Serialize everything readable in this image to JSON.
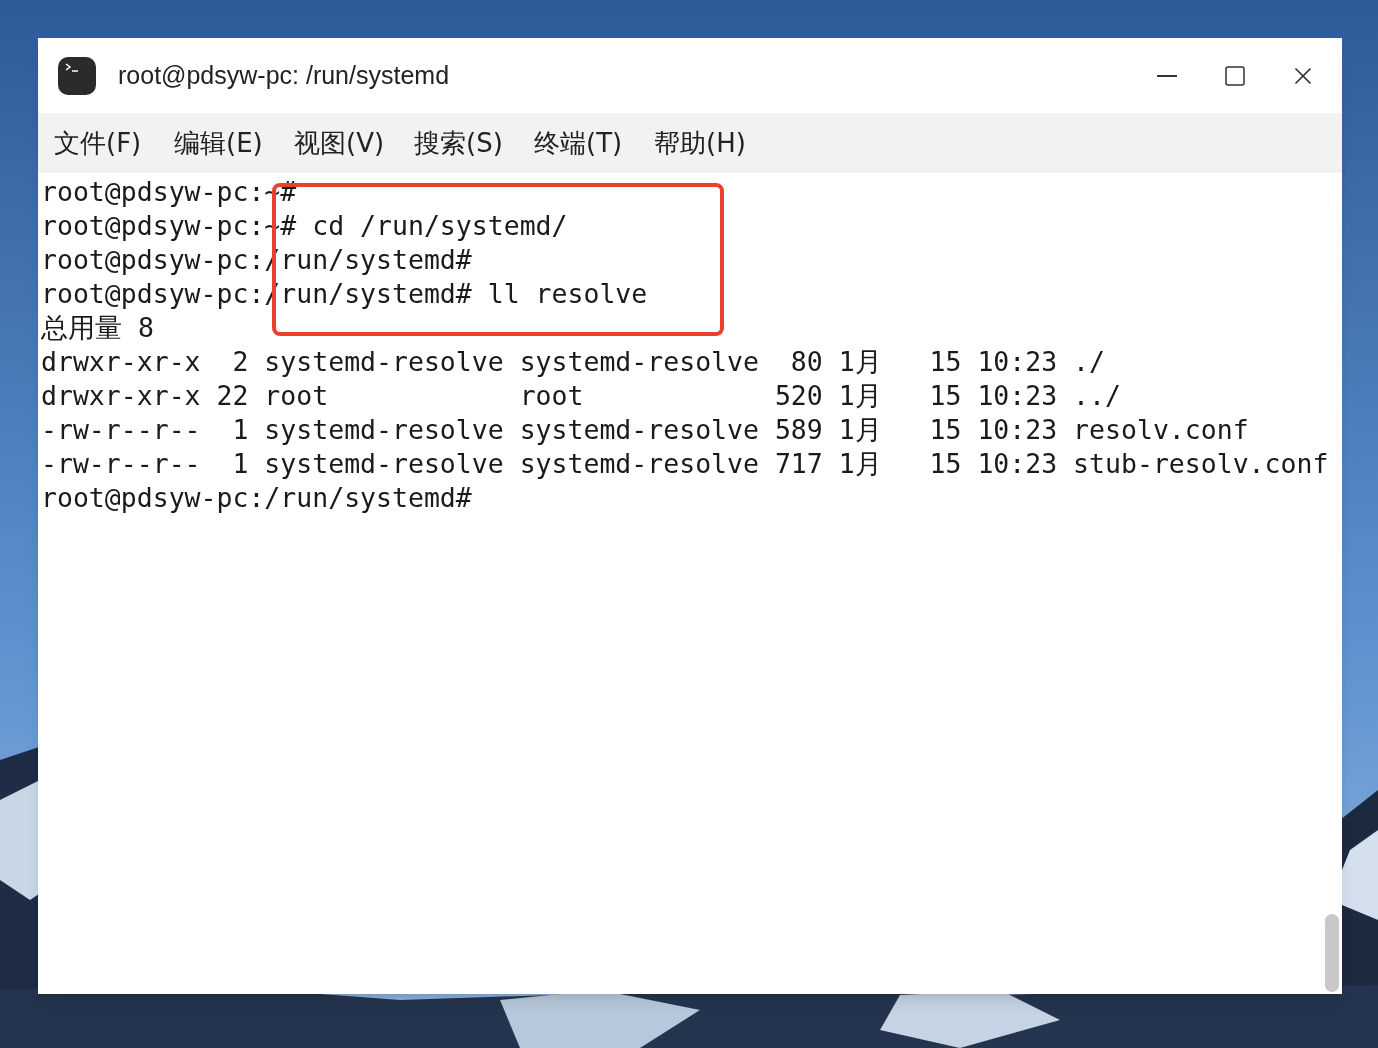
{
  "window": {
    "title": "root@pdsyw-pc: /run/systemd"
  },
  "menu": [
    "文件(F)",
    "编辑(E)",
    "视图(V)",
    "搜索(S)",
    "终端(T)",
    "帮助(H)"
  ],
  "terminal": {
    "lines": [
      "root@pdsyw-pc:~#",
      "root@pdsyw-pc:~# cd /run/systemd/",
      "root@pdsyw-pc:/run/systemd#",
      "root@pdsyw-pc:/run/systemd# ll resolve",
      "总用量 8",
      "drwxr-xr-x  2 systemd-resolve systemd-resolve  80 1月   15 10:23 ./",
      "drwxr-xr-x 22 root            root            520 1月   15 10:23 ../",
      "-rw-r--r--  1 systemd-resolve systemd-resolve 589 1月   15 10:23 resolv.conf",
      "-rw-r--r--  1 systemd-resolve systemd-resolve 717 1月   15 10:23 stub-resolv.conf",
      "root@pdsyw-pc:/run/systemd#"
    ],
    "highlight": {
      "color": "#e8412c"
    }
  }
}
